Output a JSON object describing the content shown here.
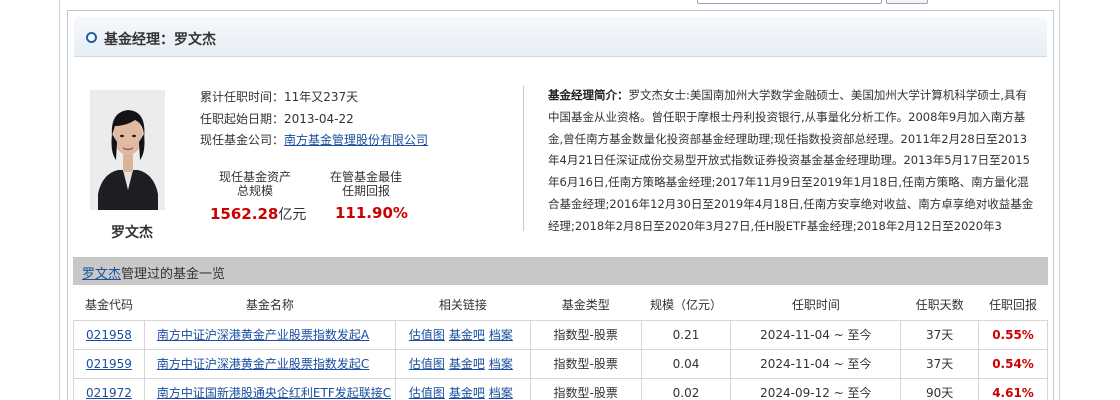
{
  "panel": {
    "title": "基金经理：罗文杰"
  },
  "manager": {
    "name": "罗文杰",
    "tenure": "累计任职时间：11年又237天",
    "start_date": "任职起始日期：2013-04-22",
    "company_label": "现任基金公司：",
    "company": "南方基金管理股份有限公司"
  },
  "stats": {
    "assets_label_1": "现任基金资产",
    "assets_label_2": "总规模",
    "assets_value": "1562.28",
    "assets_unit": "亿元",
    "return_label_1": "在管基金最佳",
    "return_label_2": "任期回报",
    "return_value": "111.90%"
  },
  "bio": {
    "label": "基金经理简介：",
    "text": "罗文杰女士:美国南加州大学数学金融硕士、美国加州大学计算机科学硕士,具有中国基金从业资格。曾任职于摩根士丹利投资银行,从事量化分析工作。2008年9月加入南方基金,曾任南方基金数量化投资部基金经理助理;现任指数投资部总经理。2011年2月28日至2013年4月21日任深证成份交易型开放式指数证券投资基金基金经理助理。2013年5月17日至2015年6月16日,任南方策略基金经理;2017年11月9日至2019年1月18日,任南方策略、南方量化混合基金经理;2016年12月30日至2019年4月18日,任南方安享绝对收益、南方卓享绝对收益基金经理;2018年2月8日至2020年3月27日,任H股ETF基金经理;2018年2月12日至2020年3"
  },
  "fund_list": {
    "manager_link": "罗文杰",
    "title_suffix": "管理过的基金一览",
    "headers": [
      "基金代码",
      "基金名称",
      "相关链接",
      "基金类型",
      "规模（亿元）",
      "任职时间",
      "任职天数",
      "任职回报"
    ],
    "rows": [
      {
        "code": "021958",
        "name": "南方中证沪深港黄金产业股票指数发起A",
        "links": [
          "估值图",
          "基金吧",
          "档案"
        ],
        "type": "指数型-股票",
        "scale": "0.21",
        "period": "2024-11-04 ~ 至今",
        "days": "37天",
        "return": "0.55%"
      },
      {
        "code": "021959",
        "name": "南方中证沪深港黄金产业股票指数发起C",
        "links": [
          "估值图",
          "基金吧",
          "档案"
        ],
        "type": "指数型-股票",
        "scale": "0.04",
        "period": "2024-11-04 ~ 至今",
        "days": "37天",
        "return": "0.54%"
      },
      {
        "code": "021972",
        "name": "南方中证国新港股通央企红利ETF发起联接C",
        "links": [
          "估值图",
          "基金吧",
          "档案"
        ],
        "type": "指数型-股票",
        "scale": "0.02",
        "period": "2024-09-12 ~ 至今",
        "days": "90天",
        "return": "4.61%"
      }
    ]
  },
  "colors": {
    "link": "#1a4fa0",
    "return_red": "#cc0000",
    "header_gray": "#c8c8c8",
    "accent_blue": "#1d5fa5"
  }
}
